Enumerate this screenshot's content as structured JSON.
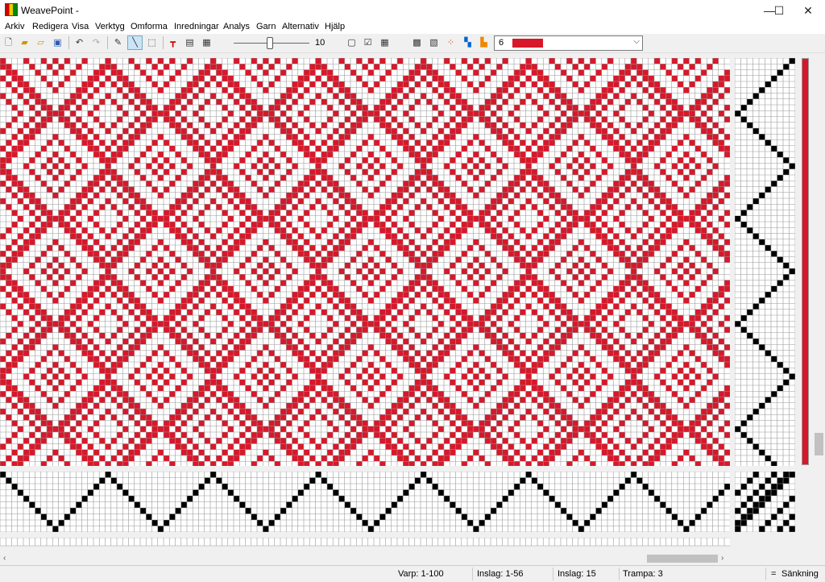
{
  "window": {
    "title": "WeavePoint -",
    "minimize": "—",
    "maximize": "☐",
    "close": "✕"
  },
  "menu": [
    "Arkiv",
    "Redigera",
    "Visa",
    "Verktyg",
    "Omforma",
    "Inredningar",
    "Analys",
    "Garn",
    "Alternativ",
    "Hjälp"
  ],
  "toolbar": {
    "zoom_value": "10",
    "color_number": "6",
    "color_hex": "#d7182a",
    "icons": [
      "new-file-icon",
      "open-folder-icon",
      "open-icon",
      "save-icon",
      "undo-icon",
      "redo-icon",
      "pencil-icon",
      "line-icon",
      "select-icon",
      "warp-color-icon",
      "fabric-view-icon",
      "pattern-view-icon",
      "page-icon",
      "checklist-icon",
      "grid-icon",
      "weave-pattern-icon",
      "inverse-pattern-icon",
      "color-dots-icon",
      "color-grid-icon",
      "palette-icon"
    ]
  },
  "colors": {
    "weave_red": "#d7182a",
    "threading_black": "#000000",
    "grid_line": "#9a9a9a",
    "background": "#ffffff"
  },
  "status": {
    "warp": "Varp: 1-100",
    "weft_range": "Inslag: 1-56",
    "weft": "Inslag: 15",
    "treadle": "Trampa: 3",
    "eq": "=",
    "mode": "Sänkning"
  }
}
